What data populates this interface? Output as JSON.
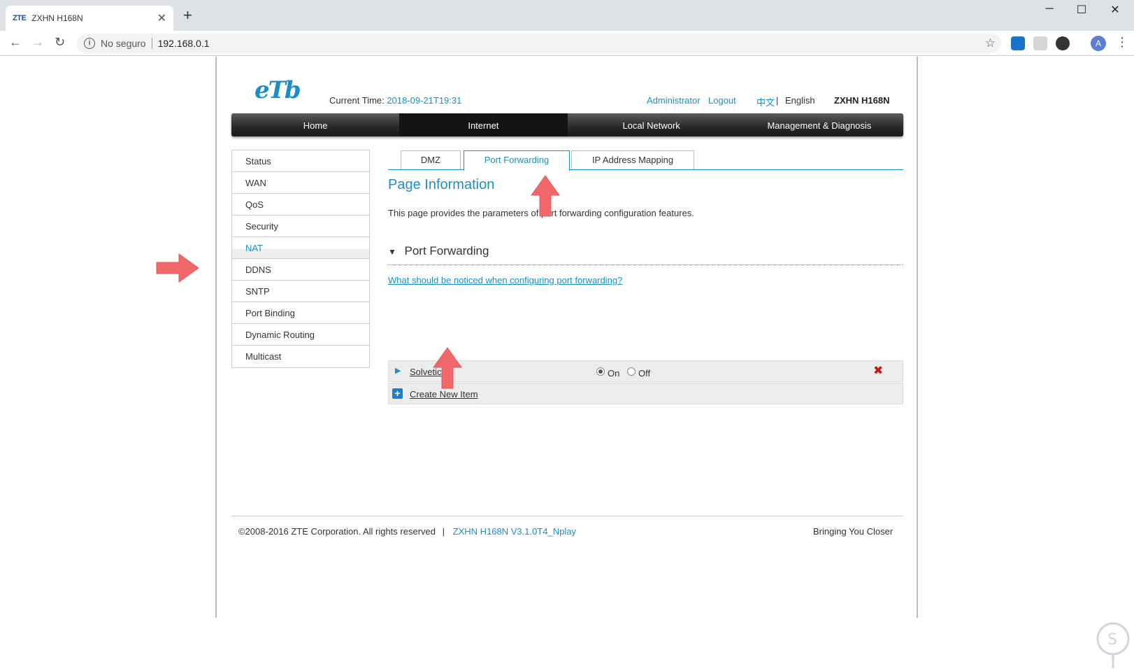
{
  "browser": {
    "tab_favicon": "ZTE",
    "tab_title": "ZXHN H168N",
    "security_text": "No seguro",
    "url": "192.168.0.1",
    "avatar_letter": "A"
  },
  "header": {
    "current_time_label": "Current Time:",
    "current_time_value": "2018-09-21T19:31",
    "administrator": "Administrator",
    "logout": "Logout",
    "lang_chinese": "中文",
    "lang_sep": "|",
    "lang_english": "English",
    "model": "ZXHN H168N",
    "logo_text": "eTb"
  },
  "mainnav": [
    {
      "label": "Home",
      "active": false
    },
    {
      "label": "Internet",
      "active": true
    },
    {
      "label": "Local Network",
      "active": false
    },
    {
      "label": "Management & Diagnosis",
      "active": false
    }
  ],
  "sidebar": [
    {
      "label": "Status"
    },
    {
      "label": "WAN"
    },
    {
      "label": "QoS"
    },
    {
      "label": "Security"
    },
    {
      "label": "NAT",
      "active": true
    },
    {
      "label": "DDNS"
    },
    {
      "label": "SNTP"
    },
    {
      "label": "Port Binding"
    },
    {
      "label": "Dynamic Routing"
    },
    {
      "label": "Multicast"
    }
  ],
  "subtabs": [
    {
      "label": "DMZ"
    },
    {
      "label": "Port Forwarding",
      "active": true
    },
    {
      "label": "IP Address Mapping"
    }
  ],
  "content": {
    "page_info_title": "Page Information",
    "page_info_desc": "This page provides the parameters of port forwarding configuration features.",
    "section_title": "Port Forwarding",
    "notice_link": "What should be noticed when configuring port forwarding?",
    "rule": {
      "name": "Solvetic",
      "on_label": "On",
      "off_label": "Off",
      "state": "On"
    },
    "create_label": "Create New Item"
  },
  "footer": {
    "copyright": "©2008-2016 ZTE Corporation. All rights reserved",
    "separator": "|",
    "version": "ZXHN H168N V3.1.0T4_Nplay",
    "tagline": "Bringing You Closer"
  },
  "colors": {
    "accent": "#1a8fc7",
    "annotation_arrow": "#f0686a",
    "delete": "#c0181b"
  }
}
